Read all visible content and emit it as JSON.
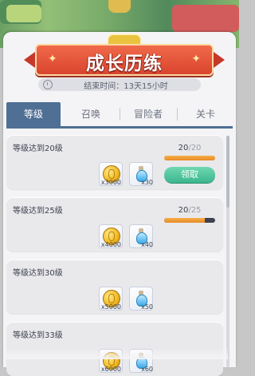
{
  "banner": {
    "title": "成长历练"
  },
  "timer": {
    "text": "结束时间：13天15小时"
  },
  "tabs": [
    {
      "label": "等级",
      "active": true
    },
    {
      "label": "召唤",
      "active": false
    },
    {
      "label": "冒险者",
      "active": false
    },
    {
      "label": "关卡",
      "active": false
    }
  ],
  "tasks": [
    {
      "label": "等级达到20级",
      "current": "20",
      "max": "20",
      "progress": 1.0,
      "coin_qty": "x3000",
      "potion_qty": "x30",
      "claim_label": "领取",
      "claimable": true
    },
    {
      "label": "等级达到25级",
      "current": "20",
      "max": "25",
      "progress": 0.8,
      "coin_qty": "x4000",
      "potion_qty": "x40",
      "claim_label": "",
      "claimable": false
    },
    {
      "label": "等级达到30级",
      "current": "",
      "max": "",
      "progress": null,
      "coin_qty": "x5000",
      "potion_qty": "x50",
      "claim_label": "",
      "claimable": false
    },
    {
      "label": "等级达到33级",
      "current": "",
      "max": "",
      "progress": null,
      "coin_qty": "x6000",
      "potion_qty": "x60",
      "claim_label": "",
      "claimable": false
    }
  ],
  "colors": {
    "banner": "#e2533a",
    "tab_active": "#4f6f94",
    "progress_fill": "#e88922",
    "claim_button": "#47bf96"
  },
  "icons": {
    "reward_1": "gold-coin-icon",
    "reward_2": "potion-icon"
  }
}
